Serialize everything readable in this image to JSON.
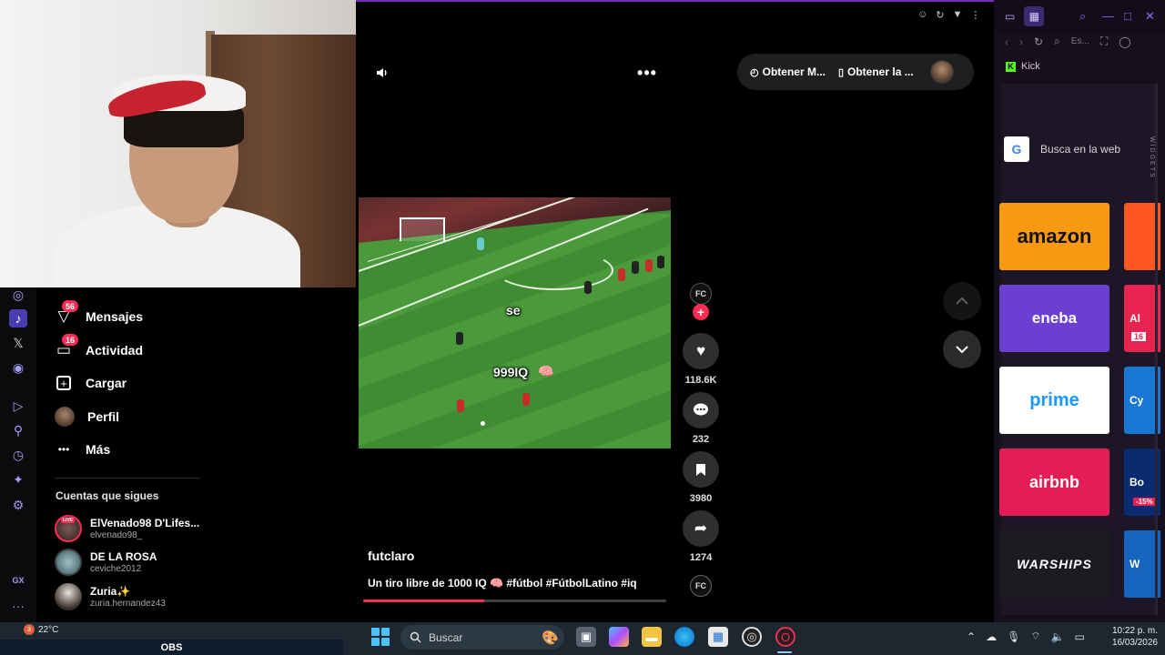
{
  "webcam": {
    "label": "webcam"
  },
  "sidebar": {
    "items": [
      {
        "label": "Mensajes",
        "icon": "send-icon",
        "badge": "56"
      },
      {
        "label": "Actividad",
        "icon": "inbox-icon",
        "badge": "16"
      },
      {
        "label": "Cargar",
        "icon": "plus-square-icon"
      },
      {
        "label": "Perfil",
        "icon": "avatar"
      },
      {
        "label": "Más",
        "icon": "more-icon"
      }
    ],
    "following_title": "Cuentas que sigues",
    "following": [
      {
        "name": "ElVenado98 D'Lifes...",
        "handle": "elvenado98_",
        "live": "LIVE"
      },
      {
        "name": "DE LA ROSA",
        "handle": "ceviche2012"
      },
      {
        "name": "Zuria✨",
        "handle": "zuria.hernandez43"
      }
    ]
  },
  "top_bar": {
    "more_label": "•••",
    "pill": [
      {
        "label": "Obtener M...",
        "icon": "music-icon"
      },
      {
        "label": "Obtener la ...",
        "icon": "phone-icon"
      }
    ]
  },
  "video": {
    "captions": [
      "se",
      "999IQ"
    ],
    "author": "futclaro",
    "description": "Un tiro libre de 1000 IQ 🧠 #fútbol #FútbolLatino #iq",
    "creator_initials": "FC",
    "progress": 0.4
  },
  "actions": [
    {
      "name": "like",
      "count": "118.6K",
      "icon": "♥"
    },
    {
      "name": "comment",
      "count": "232",
      "icon": "●●●"
    },
    {
      "name": "save",
      "count": "3980",
      "icon": "▮"
    },
    {
      "name": "share",
      "count": "1274",
      "icon": "➦"
    }
  ],
  "gx": {
    "address": "Es...",
    "kick_label": "Kick",
    "search_placeholder": "Busca en la web",
    "widgets_label": "WIDGETS",
    "tiles": [
      {
        "label": "amazon",
        "color": "#f79a12"
      },
      {
        "label": "eneba",
        "color": "#6b3fd1"
      },
      {
        "label": "prime",
        "color": "#ffffff"
      },
      {
        "label": "airbnb",
        "color": "#e41d57"
      },
      {
        "label": "WARSHIPS",
        "color": "#1b1b22"
      }
    ],
    "side_tiles": [
      {
        "label": "",
        "color": "#ff5722"
      },
      {
        "label": "Al",
        "color": "#e8234f",
        "badge": "16"
      },
      {
        "label": "Cy",
        "color": "#1976d2"
      },
      {
        "label": "Bo",
        "color": "#0b2a6f",
        "badge": "-15%"
      },
      {
        "label": "W",
        "color": "#1565c0"
      }
    ]
  },
  "taskbar": {
    "weather": "22°C",
    "weather_badge": "3",
    "obs": "OBS",
    "search_placeholder": "Buscar",
    "time": "10:22 p. m.",
    "date": "16/03/2026"
  }
}
